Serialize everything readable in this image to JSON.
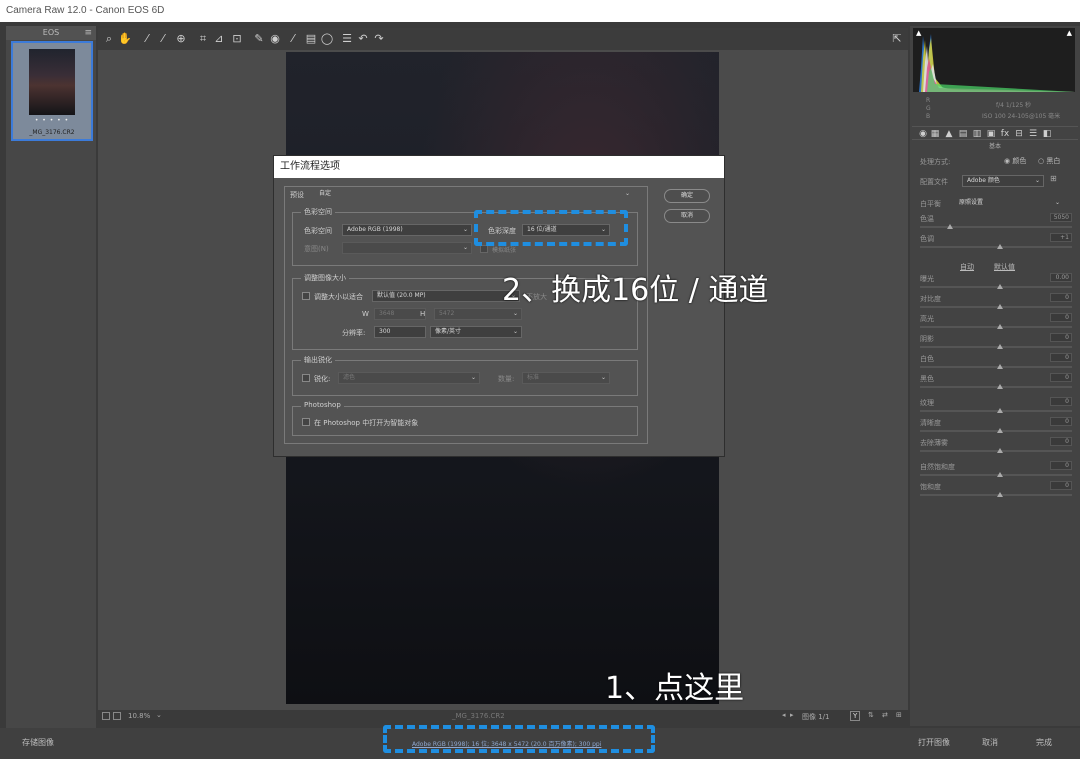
{
  "window": {
    "title": "Camera Raw 12.0 - Canon EOS 6D"
  },
  "filmstrip": {
    "header": "EOS",
    "menu_icon": "menu-icon",
    "thumbnail": {
      "stars": "• • • • •",
      "filename": "_MG_3176.CR2"
    }
  },
  "toolbar": {
    "tools": [
      "zoom-icon",
      "hand-icon",
      "white-balance-icon",
      "color-sampler-icon",
      "targeted-adjustment-icon",
      "crop-icon",
      "straighten-icon",
      "transform-icon",
      "spot-removal-icon",
      "red-eye-icon",
      "adjustment-brush-icon",
      "graduated-filter-icon",
      "radial-filter-icon",
      "preferences-icon",
      "rotate-left-icon",
      "rotate-right-icon"
    ],
    "fullscreen_icon": "fullscreen-icon"
  },
  "canvas": {
    "zoom": "10.8%",
    "filename": "_MG_3176.CR2",
    "nav_label": "图像 1/1"
  },
  "bottom": {
    "save_label": "存储图像",
    "workflow_link": "Adobe RGB (1998); 16 位; 3648 x 5472 (20.0 百万像素); 300 ppi",
    "open_label": "打开图像",
    "cancel_label": "取消",
    "done_label": "完成"
  },
  "right_panel": {
    "camera_info_left": [
      "R",
      "G",
      "B"
    ],
    "camera_info_right": [
      "f/4   1/125 秒",
      "ISO 100   24-105@105 毫米"
    ],
    "section_title": "基本",
    "treatment_label": "处理方式:",
    "treatment_color": "颜色",
    "treatment_bw": "黑白",
    "profile_label": "配置文件",
    "profile_value": "Adobe 颜色",
    "wb_label": "白平衡",
    "wb_value": "原照设置",
    "auto_label": "自动",
    "default_label": "默认值",
    "sliders": [
      {
        "label": "色温",
        "value": "5050"
      },
      {
        "label": "色调",
        "value": "+1"
      },
      {
        "label": "曝光",
        "value": "0.00"
      },
      {
        "label": "对比度",
        "value": "0"
      },
      {
        "label": "高光",
        "value": "0"
      },
      {
        "label": "阴影",
        "value": "0"
      },
      {
        "label": "白色",
        "value": "0"
      },
      {
        "label": "黑色",
        "value": "0"
      },
      {
        "label": "纹理",
        "value": "0"
      },
      {
        "label": "清晰度",
        "value": "0"
      },
      {
        "label": "去除薄雾",
        "value": "0"
      },
      {
        "label": "自然饱和度",
        "value": "0"
      },
      {
        "label": "饱和度",
        "value": "0"
      }
    ]
  },
  "dialog": {
    "title": "工作流程选项",
    "preset_label": "预设",
    "preset_value": "自定",
    "ok_label": "确定",
    "cancel_label": "取消",
    "color_space_group": "色彩空间",
    "color_space_label": "色彩空间",
    "color_space_value": "Adobe RGB (1998)",
    "bit_depth_label": "色彩深度",
    "bit_depth_value": "16 位/通道",
    "intent_label": "意图(N)",
    "intent_value": "",
    "simulate_label": "模拟纸张",
    "resize_group": "调整图像大小",
    "resize_fit_label": "调整大小以适合",
    "resize_fit_value": "默认值 (20.0 MP)",
    "enlarge_label": "不放大",
    "w_label": "W",
    "w_value": "3648",
    "h_label": "H",
    "h_value": "5472",
    "resolution_label": "分辨率:",
    "resolution_value": "300",
    "resolution_unit": "像素/英寸",
    "sharpen_group": "输出锐化",
    "sharpen_label": "锐化:",
    "sharpen_value": "滤色",
    "amount_label": "数量:",
    "amount_value": "标准",
    "photoshop_group": "Photoshop",
    "smart_object_label": "在 Photoshop 中打开为智能对象"
  },
  "annotations": {
    "step2": "2、换成16位 / 通道",
    "step1": "1、点这里"
  }
}
